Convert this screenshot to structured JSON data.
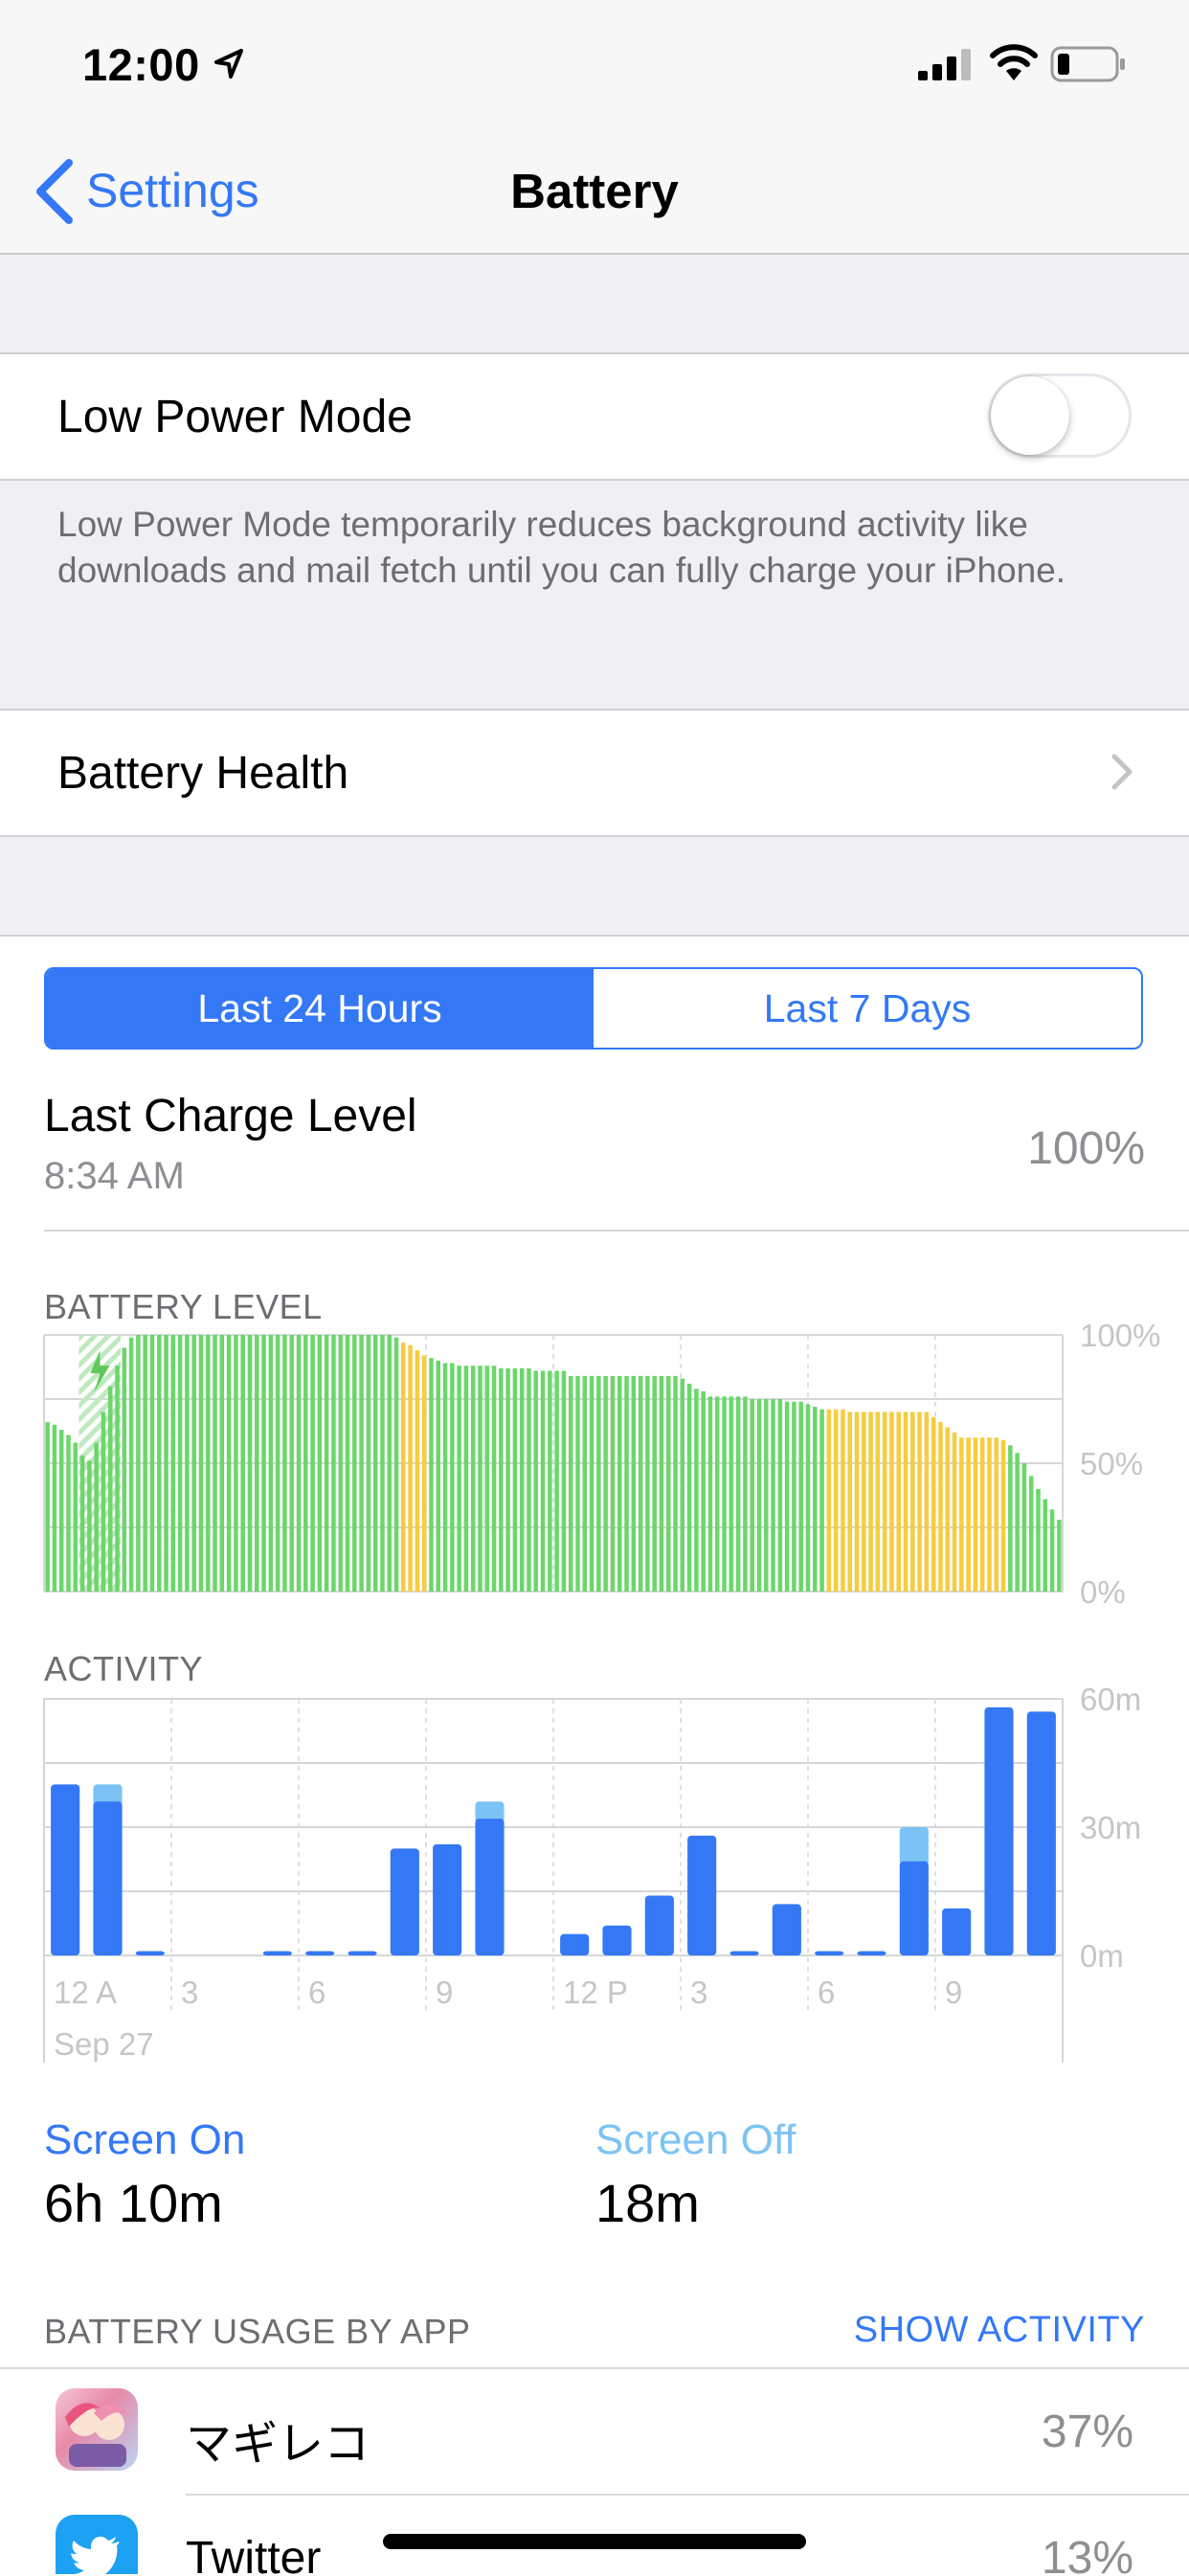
{
  "status_bar": {
    "time": "12:00"
  },
  "nav": {
    "back_label": "Settings",
    "title": "Battery"
  },
  "low_power": {
    "label": "Low Power Mode",
    "enabled": false,
    "footer": "Low Power Mode temporarily reduces background activity like downloads and mail fetch until you can fully charge your iPhone."
  },
  "battery_health": {
    "label": "Battery Health"
  },
  "segments": {
    "tabs": [
      "Last 24 Hours",
      "Last 7 Days"
    ],
    "selected": 0
  },
  "last_charge": {
    "label": "Last Charge Level",
    "time": "8:34 AM",
    "value": "100%"
  },
  "colors": {
    "accent": "#3478f6",
    "green": "#6cd66b",
    "yellow": "#f6cc40",
    "blue_on": "#3478f6",
    "blue_off": "#7cc3f5"
  },
  "chart_data": [
    {
      "type": "bar",
      "title": "BATTERY LEVEL",
      "y_tick_labels": [
        "100%",
        "50%",
        "0%"
      ],
      "ylim": [
        0,
        100
      ],
      "charging_start_index": 5,
      "charging_end_index": 11,
      "values": [
        66,
        65,
        63,
        61,
        58,
        53,
        51,
        58,
        70,
        80,
        88,
        95,
        99,
        100,
        100,
        100,
        100,
        100,
        100,
        100,
        100,
        100,
        100,
        100,
        100,
        100,
        100,
        100,
        100,
        100,
        100,
        100,
        100,
        100,
        100,
        100,
        100,
        100,
        100,
        100,
        100,
        100,
        100,
        100,
        100,
        100,
        100,
        100,
        100,
        100,
        99,
        97,
        96,
        94,
        92,
        91,
        90,
        89,
        89,
        88,
        88,
        88,
        88,
        88,
        88,
        87,
        87,
        87,
        87,
        87,
        86,
        86,
        86,
        86,
        86,
        84,
        84,
        84,
        84,
        84,
        84,
        84,
        84,
        84,
        84,
        84,
        84,
        84,
        84,
        84,
        84,
        83,
        81,
        79,
        78,
        76,
        76,
        76,
        76,
        76,
        76,
        75,
        75,
        75,
        75,
        75,
        74,
        74,
        74,
        73,
        72,
        71,
        71,
        71,
        71,
        70,
        70,
        70,
        70,
        70,
        70,
        70,
        70,
        70,
        70,
        70,
        70,
        68,
        66,
        64,
        62,
        60,
        60,
        60,
        60,
        60,
        60,
        59,
        57,
        54,
        50,
        45,
        40,
        36,
        32,
        28
      ],
      "colors": [
        "g",
        "g",
        "g",
        "g",
        "g",
        "g",
        "g",
        "g",
        "g",
        "g",
        "g",
        "g",
        "g",
        "g",
        "g",
        "g",
        "g",
        "g",
        "g",
        "g",
        "g",
        "g",
        "g",
        "g",
        "g",
        "g",
        "g",
        "g",
        "g",
        "g",
        "g",
        "g",
        "g",
        "g",
        "g",
        "g",
        "g",
        "g",
        "g",
        "g",
        "g",
        "g",
        "g",
        "g",
        "g",
        "g",
        "g",
        "g",
        "g",
        "g",
        "g",
        "y",
        "y",
        "y",
        "y",
        "g",
        "g",
        "g",
        "g",
        "g",
        "g",
        "g",
        "g",
        "g",
        "g",
        "g",
        "g",
        "g",
        "g",
        "g",
        "g",
        "g",
        "g",
        "g",
        "g",
        "g",
        "g",
        "g",
        "g",
        "g",
        "g",
        "g",
        "g",
        "g",
        "g",
        "g",
        "g",
        "g",
        "g",
        "g",
        "g",
        "g",
        "g",
        "g",
        "g",
        "g",
        "g",
        "g",
        "g",
        "g",
        "g",
        "g",
        "g",
        "g",
        "g",
        "g",
        "g",
        "g",
        "g",
        "g",
        "g",
        "g",
        "y",
        "y",
        "y",
        "y",
        "y",
        "y",
        "y",
        "y",
        "y",
        "y",
        "y",
        "y",
        "y",
        "y",
        "y",
        "y",
        "y",
        "y",
        "y",
        "y",
        "y",
        "y",
        "y",
        "y",
        "y",
        "y",
        "g",
        "g",
        "g",
        "g",
        "g",
        "g",
        "g",
        "g",
        "y",
        "y",
        "y",
        "y",
        "y",
        "y",
        "y"
      ]
    },
    {
      "type": "bar",
      "title": "ACTIVITY",
      "y_tick_labels": [
        "60m",
        "30m",
        "0m"
      ],
      "ylim": [
        0,
        60
      ],
      "x_tick_labels": [
        "12 A",
        "3",
        "6",
        "9",
        "12 P",
        "3",
        "6",
        "9"
      ],
      "date_label": "Sep 27",
      "series": [
        {
          "name": "Screen On",
          "values": [
            40,
            36,
            1,
            0,
            0,
            1,
            1,
            1,
            25,
            26,
            32,
            0,
            5,
            7,
            14,
            28,
            1,
            12,
            1,
            1,
            22,
            11,
            58,
            57
          ]
        },
        {
          "name": "Screen Off",
          "values": [
            0,
            4,
            0,
            0,
            0,
            0,
            0,
            0,
            0,
            0,
            4,
            0,
            0,
            0,
            0,
            0,
            0,
            0,
            0,
            0,
            8,
            0,
            0,
            0
          ]
        }
      ]
    }
  ],
  "screen_stats": {
    "on_label": "Screen On",
    "on_value": "6h 10m",
    "off_label": "Screen Off",
    "off_value": "18m"
  },
  "usage": {
    "header": "BATTERY USAGE BY APP",
    "show_activity": "SHOW ACTIVITY",
    "apps": [
      {
        "name": "マギレコ",
        "percent": "37%",
        "icon": "magireco-app-icon"
      },
      {
        "name": "Twitter",
        "percent": "13%",
        "icon": "twitter-bird-icon"
      }
    ]
  }
}
